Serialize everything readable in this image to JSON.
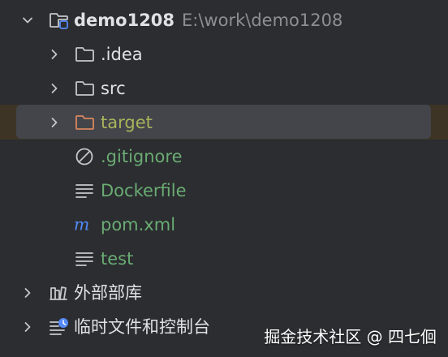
{
  "project": {
    "name": "demo1208",
    "path": "E:\\work\\demo1208"
  },
  "items": [
    {
      "label": ".idea",
      "icon": "folder-icon",
      "expanded": false
    },
    {
      "label": "src",
      "icon": "folder-icon",
      "expanded": false
    },
    {
      "label": "target",
      "icon": "excluded-folder-icon",
      "expanded": false,
      "selected": true
    },
    {
      "label": ".gitignore",
      "icon": "ignore-file-icon"
    },
    {
      "label": "Dockerfile",
      "icon": "text-file-icon"
    },
    {
      "label": "pom.xml",
      "icon": "maven-icon"
    },
    {
      "label": "test",
      "icon": "text-file-icon"
    }
  ],
  "external_libraries": {
    "label": "外部部库"
  },
  "scratches": {
    "label": "临时文件和控制台"
  },
  "watermark": "掘金技术社区 @ 四七佪",
  "colors": {
    "background": "#2b2d30",
    "selection": "#43454a",
    "vcs_added_text": "#6aab73",
    "excluded_text": "#a9b35a",
    "excluded_folder": "#d9865e",
    "path_hint": "#8c8f94"
  }
}
